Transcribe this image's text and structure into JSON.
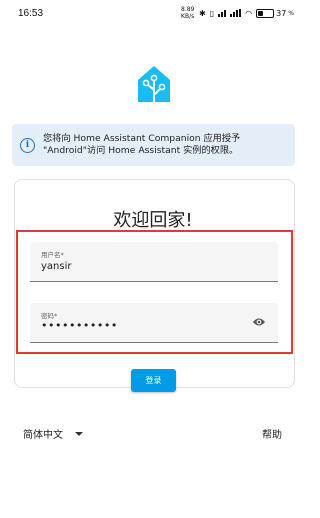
{
  "status_bar": {
    "time": "16:53",
    "data_speed": "8.89 KB/s",
    "battery": "37"
  },
  "info": {
    "line1": "您将向 Home Assistant Companion 应用授予",
    "line2": "\"Android\"访问 Home Assistant 实例的权限。"
  },
  "login": {
    "title": "欢迎回家!",
    "username_label": "用户名*",
    "username_value": "yansir",
    "password_label": "密码*",
    "password_value": "•••••••••••",
    "submit_label": "登录"
  },
  "footer": {
    "language": "简体中文",
    "help": "帮助"
  },
  "colors": {
    "brand": "#18bcf2",
    "button": "#039be5",
    "info_bg": "#e4eef8",
    "highlight": "#e53935"
  }
}
